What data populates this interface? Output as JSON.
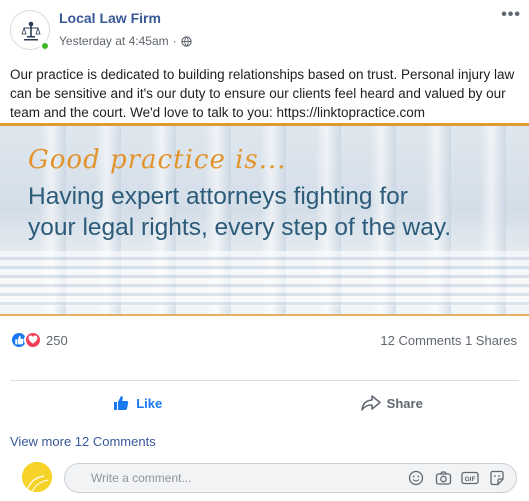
{
  "post": {
    "page_name": "Local Law Firm",
    "timestamp": "Yesterday at 4:45am",
    "separator": "·",
    "more_label": "•••",
    "text": "Our practice is dedicated to building relationships based on trust. Personal injury law can be sensitive and it's our duty to ensure our clients feel heard and valued by our team and the court. We'd love to talk to you: https://linktopractice.com",
    "banner": {
      "tagline": "Good practice is...",
      "headline_line1": "Having expert attorneys fighting for",
      "headline_line2": "your legal rights, every step of the way."
    }
  },
  "stats": {
    "reaction_count": "250",
    "comments_shares": "12 Comments 1 Shares"
  },
  "actions": {
    "like_label": "Like",
    "share_label": "Share"
  },
  "comments": {
    "view_more": "View more 12 Comments",
    "placeholder": "Write a comment..."
  },
  "colors": {
    "link_blue": "#385898",
    "like_blue": "#1877f2",
    "love_red": "#f33e58",
    "online_green": "#42b72a",
    "banner_orange": "#e3932b",
    "banner_navy": "#2d5c7a"
  },
  "icons": [
    "globe-icon",
    "more-options-icon",
    "like-reaction-icon",
    "love-reaction-icon",
    "thumbs-up-icon",
    "share-arrow-icon",
    "emoji-icon",
    "camera-icon",
    "gif-icon",
    "sticker-icon"
  ]
}
